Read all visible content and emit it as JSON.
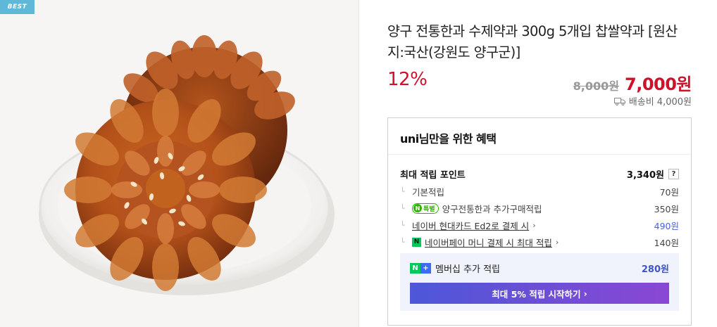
{
  "badge": {
    "label": "BEST"
  },
  "product": {
    "title": "양구 전통한과 수제약과 300g 5개입 찹쌀약과 [원산지:국산(강원도 양구군)]",
    "discount": "12%",
    "original_price": "8,000원",
    "sale_price": "7,000원",
    "shipping": "배송비 4,000원"
  },
  "benefit": {
    "title": "uni님만을 위한 혜택",
    "points_label": "최대 적립 포인트",
    "points_value": "3,340원",
    "help_label": "?",
    "details": [
      {
        "label": "기본적립",
        "value": "70원"
      },
      {
        "badge": "특별",
        "label": "양구전통한과 추가구매적립",
        "value": "350원"
      },
      {
        "label": "네이버 현대카드 Ed2로 결제 시",
        "value": "490원"
      },
      {
        "label": "네이버페이 머니 결제 시 최대 적립",
        "value": "140원"
      }
    ],
    "membership": {
      "label": "멤버십 추가 적립",
      "value": "280원",
      "button_label": "최대 5% 적립 시작하기"
    }
  },
  "colors": {
    "accent_red": "#d0112b",
    "naver_green": "#03c75a",
    "link_blue": "#4464d8"
  },
  "icons": [
    "truck-icon",
    "help-icon",
    "naver-special-icon",
    "npay-icon",
    "naver-plus-icon",
    "chevron-right-icon"
  ]
}
